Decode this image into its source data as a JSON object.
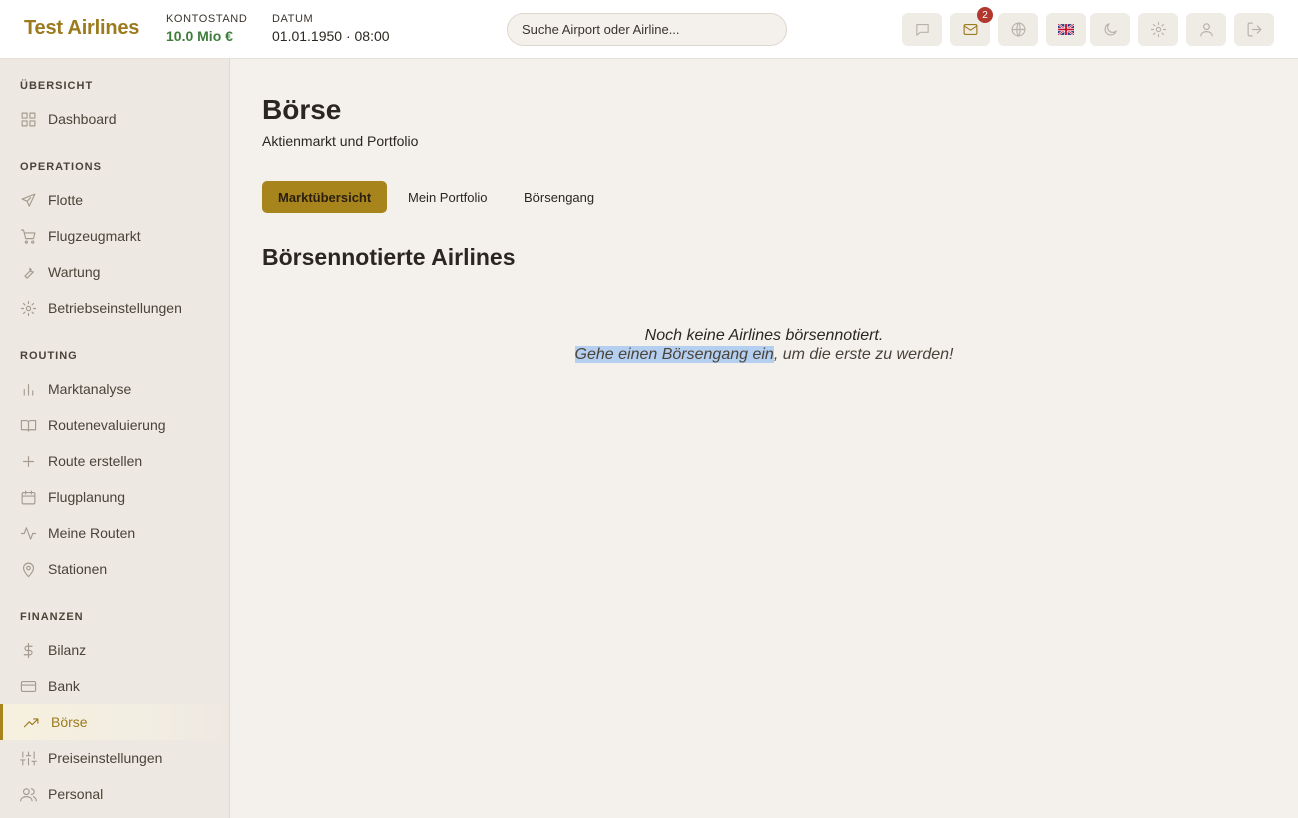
{
  "header": {
    "brand": "Test Airlines",
    "balance_label": "KONTOSTAND",
    "balance_value": "10.0 Mio €",
    "date_label": "DATUM",
    "date_value": "01.01.1950 · 08:00",
    "search_placeholder": "Suche Airport oder Airline...",
    "mail_badge": "2",
    "icons": [
      "chat-icon",
      "mail-icon",
      "globe-icon",
      "uk-flag-icon",
      "moon-icon",
      "gear-icon",
      "user-icon",
      "logout-icon"
    ]
  },
  "sidebar": {
    "sections": [
      {
        "title": "ÜBERSICHT",
        "items": [
          {
            "label": "Dashboard",
            "icon": "grid-icon"
          }
        ]
      },
      {
        "title": "OPERATIONS",
        "items": [
          {
            "label": "Flotte",
            "icon": "plane-icon"
          },
          {
            "label": "Flugzeugmarkt",
            "icon": "cart-icon"
          },
          {
            "label": "Wartung",
            "icon": "wrench-icon"
          },
          {
            "label": "Betriebseinstellungen",
            "icon": "gear-icon"
          }
        ]
      },
      {
        "title": "ROUTING",
        "items": [
          {
            "label": "Marktanalyse",
            "icon": "bar-chart-icon"
          },
          {
            "label": "Routenevaluierung",
            "icon": "book-icon"
          },
          {
            "label": "Route erstellen",
            "icon": "plus-icon"
          },
          {
            "label": "Flugplanung",
            "icon": "calendar-icon"
          },
          {
            "label": "Meine Routen",
            "icon": "activity-icon"
          },
          {
            "label": "Stationen",
            "icon": "map-pin-icon"
          }
        ]
      },
      {
        "title": "FINANZEN",
        "items": [
          {
            "label": "Bilanz",
            "icon": "dollar-icon"
          },
          {
            "label": "Bank",
            "icon": "credit-card-icon"
          },
          {
            "label": "Börse",
            "icon": "trending-up-icon"
          },
          {
            "label": "Preiseinstellungen",
            "icon": "sliders-icon"
          },
          {
            "label": "Personal",
            "icon": "users-icon"
          }
        ]
      }
    ]
  },
  "main": {
    "title": "Börse",
    "subtitle": "Aktienmarkt und Portfolio",
    "tabs": [
      "Marktübersicht",
      "Mein Portfolio",
      "Börsengang"
    ],
    "section_title": "Börsennotierte Airlines",
    "empty_line1": "Noch keine Airlines börsennotiert.",
    "empty_link": "Gehe einen Börsengang ein",
    "empty_rest": ", um die erste zu werden!"
  },
  "colors": {
    "accent": "#a8841d",
    "brand": "#9c7a1e",
    "money": "#3e7d3a",
    "badge": "#b2382e",
    "background": "#f4f1ec",
    "sidebar": "#ede8e1"
  }
}
